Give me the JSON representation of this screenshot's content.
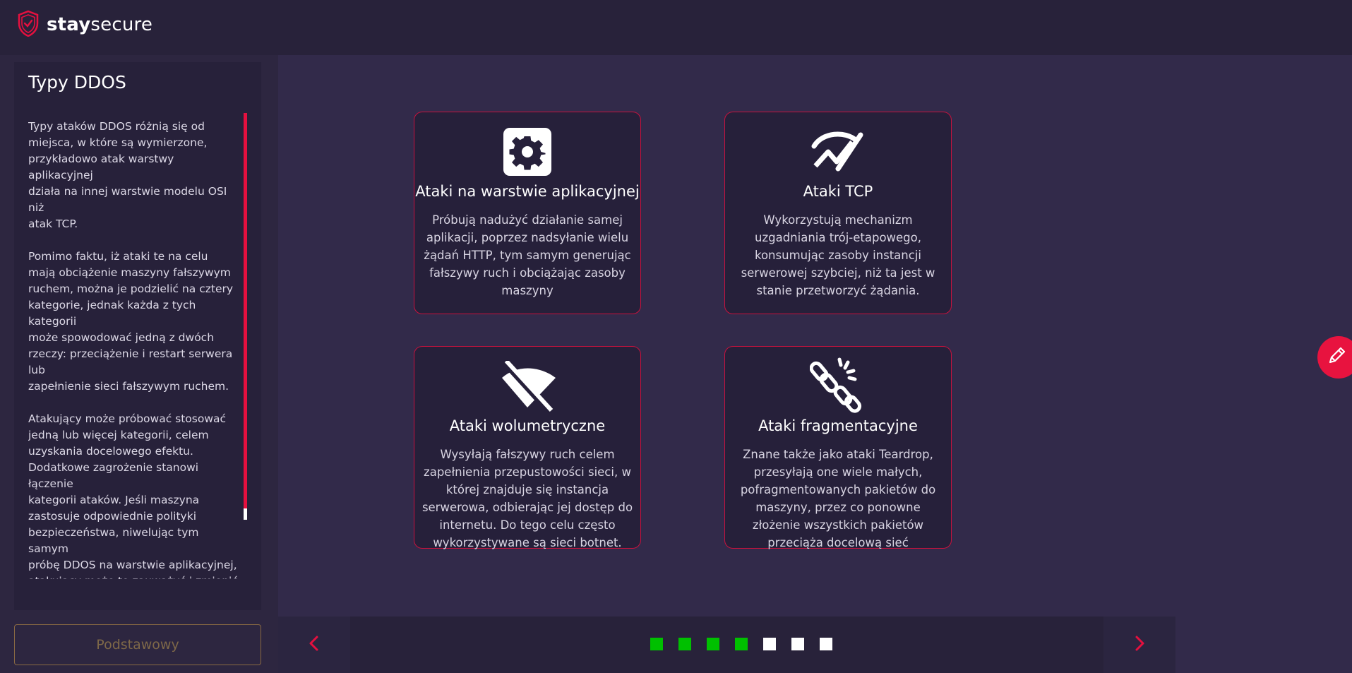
{
  "app": {
    "logo_bold": "stay",
    "logo_light": "secure",
    "accent_color": "#e5103f",
    "logo_icon": "shield-check-icon"
  },
  "sidebar": {
    "title": "Typy DDOS",
    "paragraphs": [
      "Typy ataków DDOS różnią się od\nmiejsca, w które są wymierzone,\nprzykładowo atak warstwy aplikacyjnej\ndziała na innej warstwie modelu OSI niż\natak TCP.",
      "Pomimo faktu, iż ataki te na celu\nmają obciążenie maszyny fałszywym\nruchem, można je podzielić na cztery\nkategorie, jednak każda z tych kategorii\nmoże spowodować jedną z dwóch\nrzeczy: przeciążenie i restart serwera lub\nzapełnienie sieci fałszywym ruchem.",
      "Atakujący może próbować stosować\njedną lub więcej kategorii, celem\nuzyskania docelowego efektu.\nDodatkowe zagrożenie stanowi łączenie\nkategorii ataków. Jeśli maszyna\nzastosuje odpowiednie polityki\nbezpieczeństwa, niwelując tym samym\npróbę DDOS na warstwie aplikacyjnej,\natakujący może to zauważyć i zmienić\nkategorię ataku, tym razem kierując\nruch na przepustowość sieci."
    ],
    "level_button": "Podstawowy"
  },
  "cards": [
    {
      "icon": "gear-icon",
      "title": "Ataki na warstwie aplikacyjnej",
      "text": "Próbują nadużyć działanie samej aplikacji, poprzez nadsyłanie wielu żądań HTTP, tym samym generując fałszywy ruch i obciążając zasoby maszyny"
    },
    {
      "icon": "broken-signal-icon",
      "title": "Ataki TCP",
      "text": "Wykorzystują mechanizm uzgadniania trój-etapowego, konsumując zasoby instancji serwerowej szybciej, niż ta jest w stanie przetworzyć żądania."
    },
    {
      "icon": "wifi-off-icon",
      "title": "Ataki wolumetryczne",
      "text": "Wysyłają fałszywy ruch celem zapełnienia przepustowości sieci, w której znajduje się instancja serwerowa, odbierając jej dostęp do internetu. Do tego celu często wykorzystywane są sieci botnet."
    },
    {
      "icon": "broken-chain-icon",
      "title": "Ataki fragmentacyjne",
      "text": "Znane także jako ataki Teardrop, przesyłają one wiele małych, pofragmentowanych pakietów do maszyny, przez co ponowne złożenie wszystkich pakietów przeciąża docelową sieć"
    }
  ],
  "pagination": {
    "total": 7,
    "completed": 4,
    "completed_color": "#00c000",
    "pending_color": "#ffffff",
    "prev_icon": "chevron-left-icon",
    "next_icon": "chevron-right-icon"
  },
  "fab": {
    "icon": "pencil-icon",
    "color": "#e8133f"
  }
}
